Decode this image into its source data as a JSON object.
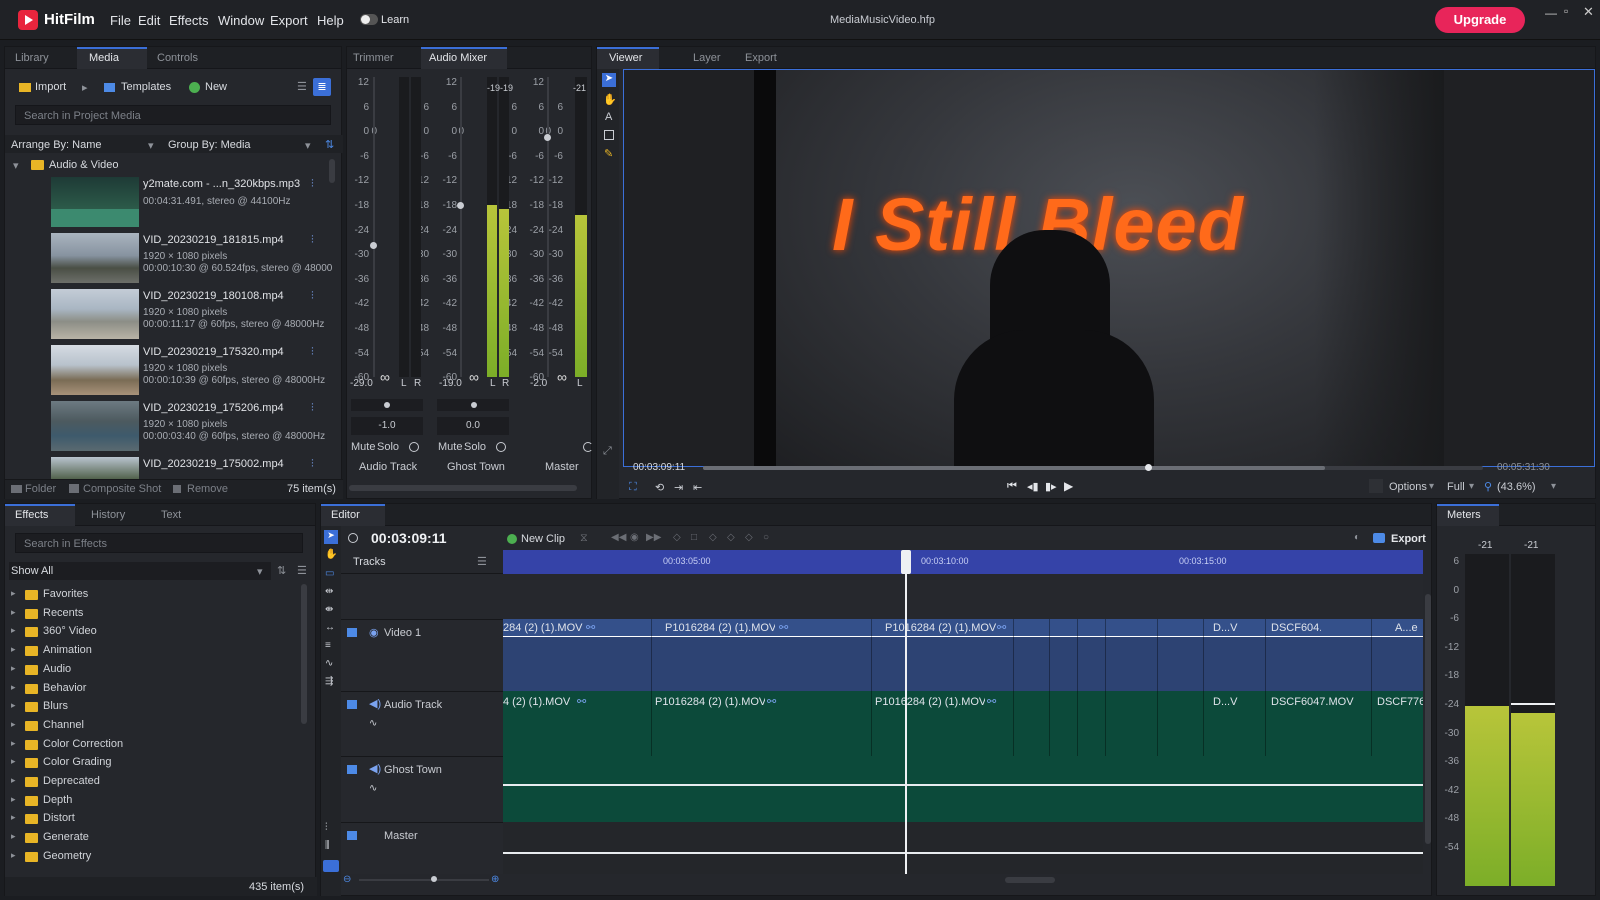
{
  "app": {
    "name": "HitFilm",
    "document_title": "MediaMusicVideo.hfp",
    "upgrade_label": "Upgrade",
    "learn_label": "Learn"
  },
  "menu": [
    "File",
    "Edit",
    "Effects",
    "Window",
    "Export",
    "Help"
  ],
  "media_panel": {
    "tabs": [
      "Library",
      "Media",
      "Controls"
    ],
    "import_label": "Import",
    "templates_label": "Templates",
    "new_label": "New",
    "search_placeholder": "Search in Project Media",
    "arrange_by": "Arrange By: Name",
    "group_by": "Group By: Media",
    "folder_name": "Audio & Video",
    "items": [
      {
        "name": "y2mate.com - ...n_320kbps.mp3",
        "meta1": "00:04:31.491, stereo @ 44100Hz",
        "meta2": ""
      },
      {
        "name": "VID_20230219_181815.mp4",
        "meta1": "1920 × 1080 pixels",
        "meta2": "00:00:10:30 @ 60.524fps, stereo @ 48000"
      },
      {
        "name": "VID_20230219_180108.mp4",
        "meta1": "1920 × 1080 pixels",
        "meta2": "00:00:11:17 @ 60fps, stereo @ 48000Hz"
      },
      {
        "name": "VID_20230219_175320.mp4",
        "meta1": "1920 × 1080 pixels",
        "meta2": "00:00:10:39 @ 60fps, stereo @ 48000Hz"
      },
      {
        "name": "VID_20230219_175206.mp4",
        "meta1": "1920 × 1080 pixels",
        "meta2": "00:00:03:40 @ 60fps, stereo @ 48000Hz"
      },
      {
        "name": "VID_20230219_175002.mp4",
        "meta1": "",
        "meta2": ""
      }
    ],
    "footer": {
      "folder": "Folder",
      "composite": "Composite Shot",
      "remove": "Remove",
      "count": "75 item(s)"
    }
  },
  "mixer_panel": {
    "tabs": [
      "Trimmer",
      "Audio Mixer"
    ],
    "scale": [
      "12",
      "6",
      "0",
      "-6",
      "-12",
      "-18",
      "-24",
      "-30",
      "-36",
      "-42",
      "-48",
      "-54",
      "-60"
    ],
    "right_scale": [
      "6",
      "0",
      "-6",
      "-12",
      "-18",
      "-24",
      "-30",
      "-36",
      "-42",
      "-48",
      "-54"
    ],
    "channels": [
      {
        "name": "Audio Track",
        "peak": "-29.0",
        "pan": "-1.0",
        "level": 0.0,
        "l_label": "L",
        "r_label": "R"
      },
      {
        "name": "Ghost Town",
        "peak": "-19.0",
        "pan": "0.0",
        "level": 0.58,
        "l_label": "L",
        "r_label": "R",
        "top_readout": "-19-19"
      },
      {
        "name": "Master",
        "peak": "-2.0",
        "level": 0.52,
        "l_label": "L",
        "top_readout": "-21"
      }
    ],
    "zero_label": "0",
    "mute_label": "Mute",
    "solo_label": "Solo"
  },
  "viewer_panel": {
    "tabs": [
      "Viewer",
      "Layer",
      "Export"
    ],
    "overlay_text": "I Still Bleed",
    "current_time": "00:03:09:11",
    "end_time": "00:05:31:30",
    "playhead_progress": 0.57,
    "options_label": "Options",
    "full_label": "Full",
    "zoom_label": "(43.6%)"
  },
  "effects_panel": {
    "tabs": [
      "Effects",
      "History",
      "Text"
    ],
    "search_placeholder": "Search in Effects",
    "show_all": "Show All",
    "folders": [
      "Favorites",
      "Recents",
      "360° Video",
      "Animation",
      "Audio",
      "Behavior",
      "Blurs",
      "Channel",
      "Color Correction",
      "Color Grading",
      "Deprecated",
      "Depth",
      "Distort",
      "Generate",
      "Geometry"
    ],
    "count": "435 item(s)"
  },
  "editor_panel": {
    "tab": "Editor",
    "timecode": "00:03:09:11",
    "new_clip_label": "New Clip",
    "export_label": "Export",
    "tracks_label": "Tracks",
    "ruler_labels": [
      "00:03:05:00",
      "00:03:10:00",
      "00:03:15:00"
    ],
    "tracks": [
      {
        "name": "Video 1",
        "clips": [
          "284 (2) (1).MOV",
          "P1016284 (2) (1).MOV",
          "P1016284 (2) (1).MOV",
          "D...V",
          "DSCF604...",
          "A...e"
        ]
      },
      {
        "name": "Audio Track",
        "clips": [
          "4 (2) (1).MOV",
          "P1016284 (2) (1).MOV",
          "P1016284 (2) (1).MOV",
          "D...V",
          "DSCF6047.MOV",
          "DSCF776"
        ]
      },
      {
        "name": "Ghost Town",
        "clips": []
      },
      {
        "name": "Master",
        "clips": []
      }
    ]
  },
  "meters_panel": {
    "tab": "Meters",
    "top_left": "-21",
    "top_right": "-21",
    "scale": [
      "6",
      "0",
      "-6",
      "-12",
      "-18",
      "-24",
      "-30",
      "-36",
      "-42",
      "-48",
      "-54"
    ],
    "left_level": 0.53,
    "right_level": 0.5
  },
  "colors": {
    "accent": "#3b6fd8",
    "upgrade": "#e8255a",
    "video_track": "#2d4373",
    "audio_track": "#0c4a3a",
    "overlay_text": "#ff6a1a"
  }
}
